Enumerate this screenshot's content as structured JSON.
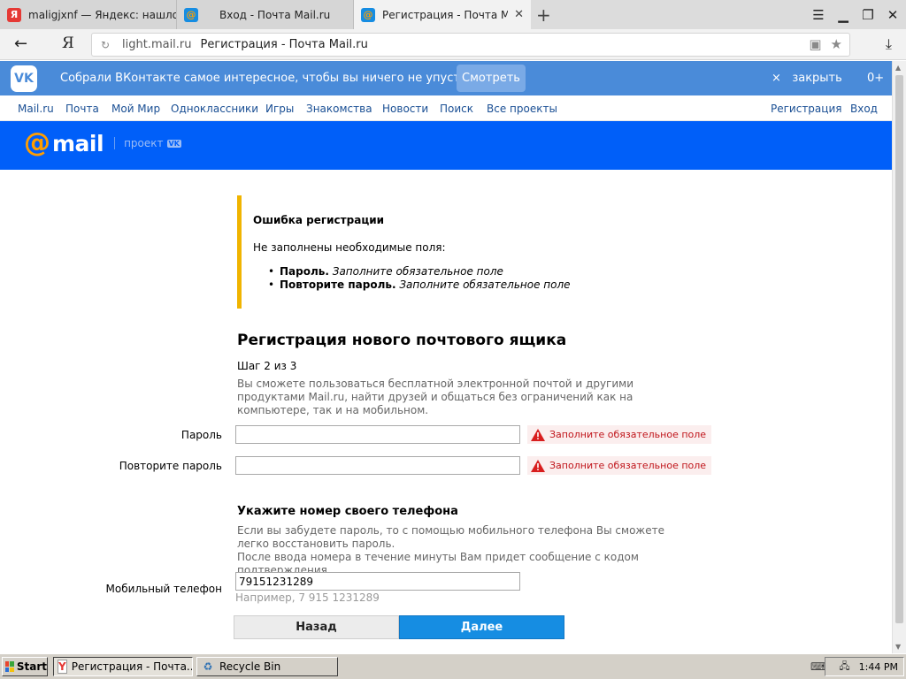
{
  "browser": {
    "tabs": [
      {
        "title": "maligjxnf — Яндекс: нашлось",
        "icon": "yandex-icon"
      },
      {
        "title": "Вход - Почта Mail.ru",
        "icon": "mail-icon"
      },
      {
        "title": "Регистрация - Почта Mail.ru",
        "icon": "mail-icon",
        "active": true
      }
    ],
    "url_host": "light.mail.ru",
    "url_title": "Регистрация - Почта Mail.ru",
    "yandex_letter": "Я"
  },
  "vk_banner": {
    "text": "Собрали ВКонтакте самое интересное, чтобы вы ничего не упустили",
    "button": "Смотреть",
    "close": "закрыть",
    "age": "0+",
    "logo": "VK"
  },
  "portal_nav": {
    "links": [
      "Mail.ru",
      "Почта",
      "Мой Мир",
      "Одноклассники",
      "Игры",
      "Знакомства",
      "Новости",
      "Поиск",
      "Все проекты"
    ],
    "register": "Регистрация",
    "login": "Вход"
  },
  "mail_header": {
    "logo_at": "@",
    "logo_word": "mail",
    "project": "проект",
    "vk_badge": "VK"
  },
  "error": {
    "title": "Ошибка регистрации",
    "description": "Не заполнены необходимые поля:",
    "items": [
      {
        "field": "Пароль.",
        "message": "Заполните обязательное поле"
      },
      {
        "field": "Повторите пароль.",
        "message": "Заполните обязательное поле"
      }
    ]
  },
  "form": {
    "title": "Регистрация нового почтового ящика",
    "step": "Шаг 2 из 3",
    "hint": "Вы сможете пользоваться бесплатной электронной почтой и другими продуктами Mail.ru, найти друзей и общаться без ограничений как на компьютере, так и на мобильном.",
    "password_label": "Пароль",
    "password_value": "",
    "password_error": "Заполните обязательное поле",
    "repeat_label": "Повторите пароль",
    "repeat_value": "",
    "repeat_error": "Заполните обязательное поле",
    "phone_title": "Укажите номер своего телефона",
    "phone_hint_1": "Если вы забудете пароль, то с помощью мобильного телефона Вы сможете легко восстановить пароль.",
    "phone_hint_2": "После ввода номера в течение минуты Вам придет сообщение с кодом подтверждения.",
    "phone_label": "Мобильный телефон",
    "phone_value": "79151231289",
    "phone_example": "Например, 7 915 1231289",
    "back_button": "Назад",
    "next_button": "Далее"
  },
  "taskbar": {
    "start": "Start",
    "tasks": [
      {
        "label": "Регистрация - Почта...",
        "pressed": true
      },
      {
        "label": "Recycle Bin",
        "pressed": false
      }
    ],
    "clock": "1:44 PM"
  },
  "colors": {
    "vk_blue": "#4a8bd9",
    "mail_blue": "#005ff9",
    "accent_orange": "#ff9e00",
    "error_red": "#c0151b",
    "next_button": "#168de2",
    "error_border": "#f0b400"
  }
}
